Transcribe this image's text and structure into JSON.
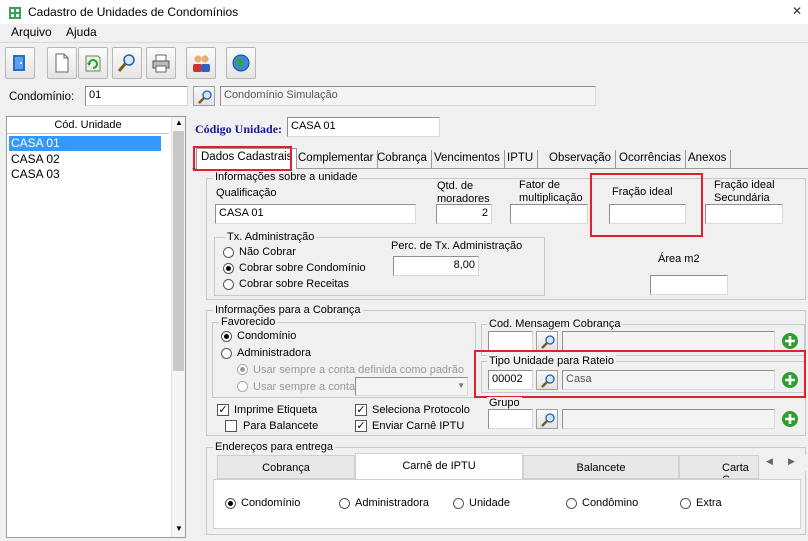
{
  "window": {
    "title": "Cadastro de Unidades de Condomínios"
  },
  "menu": {
    "items": [
      "Arquivo",
      "Ajuda"
    ]
  },
  "toolbar": {
    "icons": [
      "exit-door-icon",
      "new-document-icon",
      "refresh-icon",
      "search-icon",
      "print-icon",
      "users-icon",
      "web-globe-icon"
    ]
  },
  "condominio": {
    "label": "Condomínio:",
    "code": "01",
    "name": "Condomínio Simulação"
  },
  "unit_list": {
    "header": "Cód. Unidade",
    "items": [
      "CASA 01",
      "CASA 02",
      "CASA 03"
    ],
    "selected": "CASA 01"
  },
  "codigo_unidade": {
    "label": "Código Unidade:",
    "value": "CASA 01"
  },
  "tabs": [
    "Dados Cadastrais",
    "Complementar",
    "Cobrança",
    "Vencimentos",
    "IPTU",
    "Observação",
    "Ocorrências",
    "Anexos"
  ],
  "active_tab": "Dados Cadastrais",
  "info_unidade": {
    "group_label": "Informações sobre a unidade",
    "qualificacao_label": "Qualificação",
    "qualificacao_value": "CASA 01",
    "moradores_label_1": "Qtd. de",
    "moradores_label_2": "moradores",
    "moradores_value": "2",
    "fator_label_1": "Fator de",
    "fator_label_2": "multiplicação",
    "fator_value": "",
    "fracao_label": "Fração ideal",
    "fracao_value": "",
    "fracao_sec_label_1": "Fração ideal",
    "fracao_sec_label_2": "Secundária",
    "fracao_sec_value": "",
    "area_label": "Área m2",
    "area_value": ""
  },
  "tx_admin": {
    "group_label": "Tx. Administração",
    "options": [
      "Não Cobrar",
      "Cobrar sobre Condomínio",
      "Cobrar sobre Receitas"
    ],
    "selected": "Cobrar sobre Condomínio",
    "perc_label": "Perc. de Tx. Administração",
    "perc_value": "8,00"
  },
  "info_cobranca": {
    "group_label": "Informações para a Cobrança",
    "favorecido_label": "Favorecido",
    "favorecido_options": [
      "Condomínio",
      "Administradora"
    ],
    "favorecido_selected": "Condomínio",
    "sub_options": [
      "Usar sempre a conta definida como padrão",
      "Usar sempre a conta"
    ],
    "sub_selected": "Usar sempre a conta definida como padrão",
    "checks": [
      {
        "label": "Imprime Etiqueta",
        "checked": true
      },
      {
        "label": "Para Balancete",
        "checked": false
      },
      {
        "label": "Seleciona Protocolo",
        "checked": true
      },
      {
        "label": "Enviar Carnê IPTU",
        "checked": true
      }
    ],
    "cod_mensagem_label": "Cod. Mensagem Cobrança",
    "cod_mensagem_code": "",
    "cod_mensagem_desc": "",
    "tipo_rateio_label": "Tipo Unidade para Rateio",
    "tipo_rateio_code": "00002",
    "tipo_rateio_desc": "Casa",
    "grupo_label": "Grupo",
    "grupo_code": "",
    "grupo_desc": ""
  },
  "enderecos": {
    "group_label": "Endereços para entrega",
    "tabs": [
      "Cobrança",
      "Carnê de IPTU",
      "Balancete",
      "Carta C"
    ],
    "active_tab": "Carnê de IPTU",
    "options": [
      "Condomínio",
      "Administradora",
      "Unidade",
      "Condômino",
      "Extra"
    ],
    "selected": "Condomínio"
  },
  "colors": {
    "highlight": "#e0202a",
    "selection": "#3399ff",
    "add_button": "#2e9e2e"
  }
}
